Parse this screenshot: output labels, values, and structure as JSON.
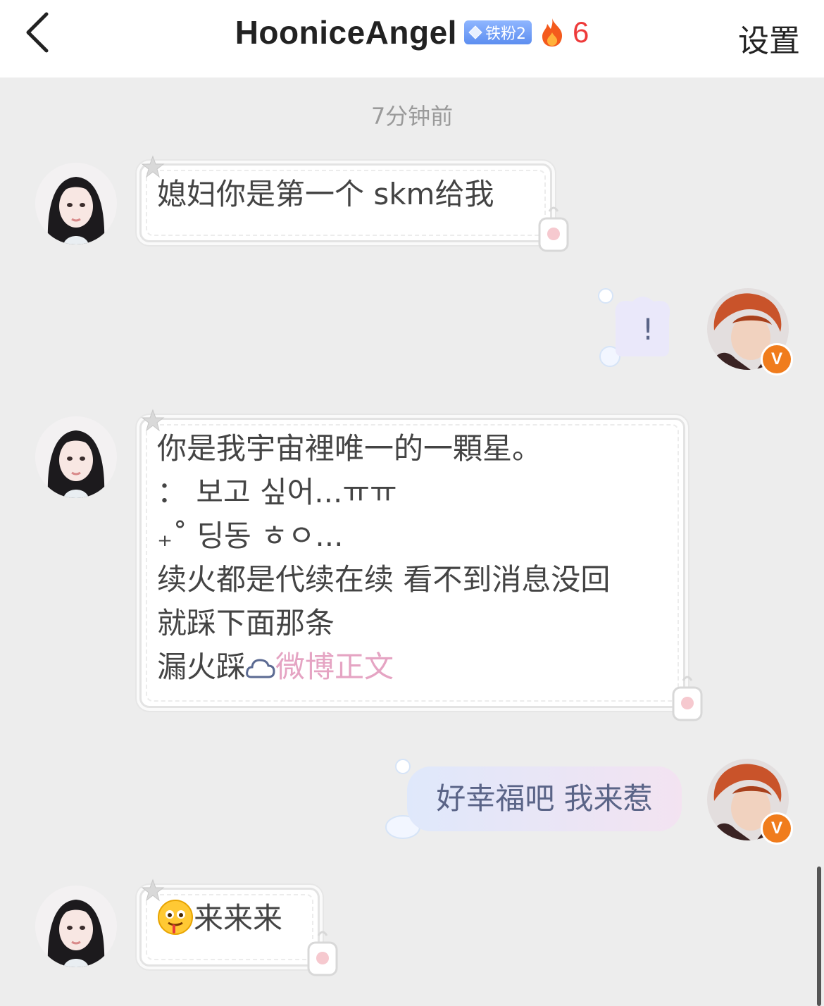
{
  "header": {
    "username": "HooniceAngel",
    "fan_badge": "铁粉2",
    "fire_count": "6",
    "settings_label": "设置"
  },
  "timestamp": "7分钟前",
  "messages": [
    {
      "side": "left",
      "text": "媳妇你是第一个 skm给我"
    },
    {
      "side": "right",
      "text": "!"
    },
    {
      "side": "left",
      "lines": [
        "你是我宇宙裡唯一的一顆星。",
        "：  보고 싶어...ㅠㅠ",
        "₊˚ 딩동 ㅎㅇ...",
        "续火都是代续在续 看不到消息没回",
        "就踩下面那条",
        "漏火踩"
      ],
      "link_text": "微博正文"
    },
    {
      "side": "right",
      "text": "好幸福吧 我来惹"
    },
    {
      "side": "left",
      "text": "来来来"
    }
  ],
  "colors": {
    "background": "#ededed",
    "fire": "#ee3a3a",
    "link": "#e5a4c3",
    "verified": "#f07c1c"
  },
  "icons": [
    "back-chevron-icon",
    "diamond-icon",
    "flame-icon",
    "verified-v-icon",
    "weibo-cloud-icon",
    "drooling-emoji-icon"
  ]
}
